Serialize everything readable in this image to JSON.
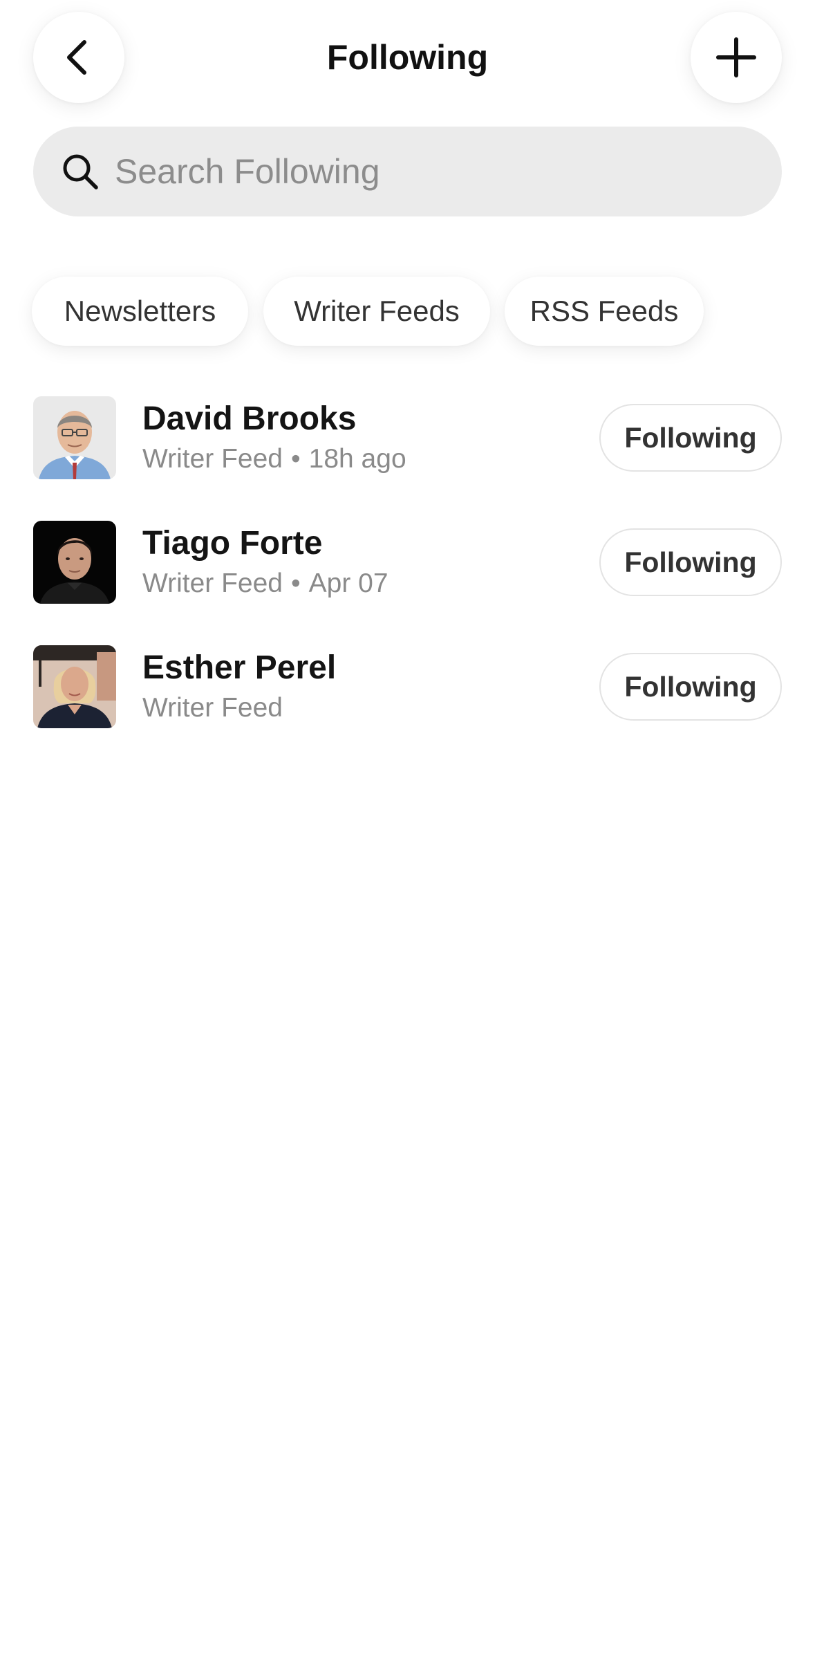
{
  "header": {
    "title": "Following",
    "back_icon": "chevron-left-icon",
    "add_icon": "plus-icon"
  },
  "search": {
    "placeholder": "Search Following",
    "value": "",
    "icon": "search-icon"
  },
  "filters": [
    {
      "label": "Newsletters"
    },
    {
      "label": "Writer Feeds"
    },
    {
      "label": "RSS Feeds"
    }
  ],
  "following": [
    {
      "name": "David Brooks",
      "type": "Writer Feed",
      "separator": "•",
      "time": "18h ago",
      "button": "Following"
    },
    {
      "name": "Tiago Forte",
      "type": "Writer Feed",
      "separator": "•",
      "time": "Apr 07",
      "button": "Following"
    },
    {
      "name": "Esther Perel",
      "type": "Writer Feed",
      "button": "Following"
    }
  ],
  "colors": {
    "background": "#ffffff",
    "search_bg": "#ebebeb",
    "placeholder": "#8c8c8c",
    "meta_text": "#8a8a8a",
    "button_border": "#e3e3e3"
  }
}
